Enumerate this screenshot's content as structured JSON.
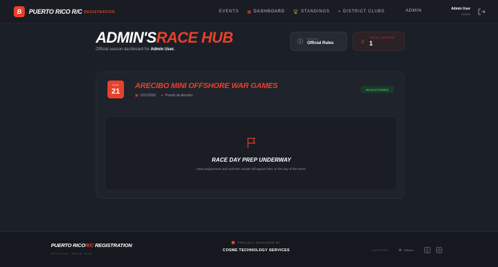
{
  "nav": {
    "brand_badge": "B",
    "brand_title": "PUERTO RICO R/C",
    "brand_sub": "REGISTRATION",
    "links": [
      {
        "label": "EVENTS",
        "icon": "none"
      },
      {
        "label": "DASHBOARD",
        "icon": "grid-icon"
      },
      {
        "label": "STANDINGS",
        "icon": "trophy-icon"
      },
      {
        "label": "DISTRICT CLUBS",
        "icon": "map-pin-icon"
      }
    ],
    "admin_label": "ADMIN",
    "user_name": "Admin User",
    "user_role": "ADMIN"
  },
  "hero": {
    "title_white": "ADMIN'S",
    "title_red": "RACE HUB",
    "subtitle_prefix": "Official season dashboard for",
    "subtitle_user": "Admin User."
  },
  "stats": {
    "rules_label": "RULES",
    "rules_value": "Official Rules",
    "events_label": "TOTAL EVENTS",
    "events_value": "1"
  },
  "event": {
    "month": "FEB",
    "day": "21",
    "title": "ARECIBO MINI OFFSHORE WAR GAMES",
    "date": "2/21/2026",
    "location": "Puerto de Arecibo",
    "badge": "REGISTERED"
  },
  "prep": {
    "title": "RACE DAY PREP UNDERWAY",
    "text": "Heat assignments and real-time results will appear here on the day of the event."
  },
  "footer": {
    "brand_white": "PUERTO RICO",
    "brand_red": "R/C",
    "brand_white2": " REGISTRATION",
    "sub": "OFFICIAL RACE HUB",
    "proudly": "PROUDLY DESIGNED BY",
    "company": "COSME TECHNOLOGY SERVICES",
    "support": "SUPPORT",
    "contact": "EMAIL"
  },
  "colors": {
    "accent": "#e8412b",
    "success": "#3ad17a",
    "gold": "#e2b23a"
  }
}
